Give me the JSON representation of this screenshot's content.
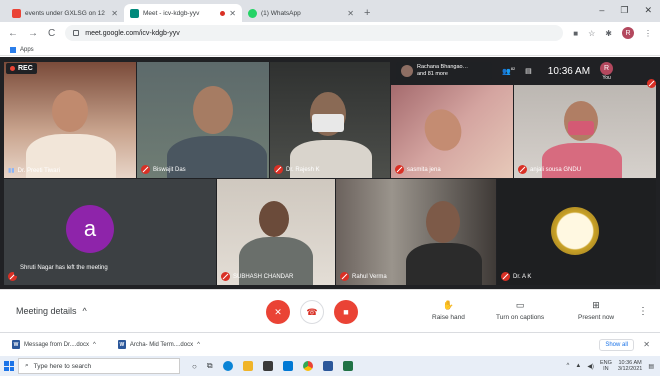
{
  "browser": {
    "tabs": [
      {
        "title": "events under GXLSG on 12 Mar…",
        "favicon_color": "#ea4335"
      },
      {
        "title": "Meet - icv-kdgb-yyv",
        "favicon_color": "#00897b"
      },
      {
        "title": "(1) WhatsApp",
        "favicon_color": "#25d366"
      }
    ],
    "url": "meet.google.com/icv-kdgb-yyv",
    "bookmarks_label": "Apps",
    "profile_initial": "R"
  },
  "meet": {
    "recording_label": "REC",
    "presenter": {
      "name": "Rachana Bhangao…",
      "more": "and 81 more"
    },
    "participants_count": "82",
    "time": "10:36 AM",
    "self_label": "You",
    "self_initial": "R",
    "tiles": [
      {
        "name": "Dr. Preeti Tiwari"
      },
      {
        "name": "Biswajit Das"
      },
      {
        "name": "Dr. Rajesh K"
      },
      {
        "name": "sasmita jena"
      },
      {
        "name": "anjali sousa GNDU"
      },
      {
        "name": "Shruti Nagar",
        "initial": "a"
      },
      {
        "name": "SUBHASH CHANDAR"
      },
      {
        "name": "Rahul Verma"
      },
      {
        "name": "Dr. A K"
      }
    ],
    "notice": "Shruti Nagar has left the meeting"
  },
  "controls": {
    "meeting_details": "Meeting details",
    "raise_hand": "Raise hand",
    "captions": "Turn on captions",
    "present": "Present now"
  },
  "downloads": {
    "items": [
      {
        "name": "Message from Dr....docx"
      },
      {
        "name": "Archa- Mid Term....docx"
      }
    ],
    "show_all": "Show all"
  },
  "taskbar": {
    "search_placeholder": "Type here to search",
    "lang": "ENG",
    "region": "IN",
    "clock_time": "10:36 AM",
    "clock_date": "3/12/2021"
  }
}
